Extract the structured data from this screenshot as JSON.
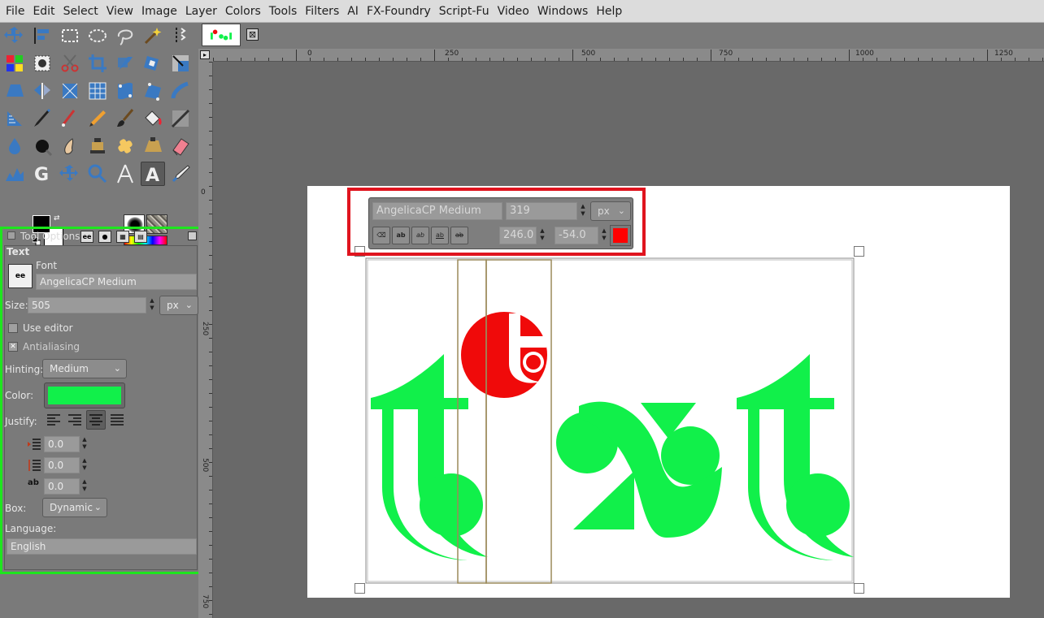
{
  "menubar": {
    "items": [
      "File",
      "Edit",
      "Select",
      "View",
      "Image",
      "Layer",
      "Colors",
      "Tools",
      "Filters",
      "AI",
      "FX-Foundry",
      "Script-Fu",
      "Video",
      "Windows",
      "Help"
    ]
  },
  "toolbox": {
    "tools": [
      "move-tool",
      "align-tool",
      "rect-select-tool",
      "ellipse-select-tool",
      "free-select-tool",
      "fuzzy-select-tool",
      "scissors-paths-tool",
      "select-by-color-tool",
      "foreground-select-tool",
      "scissors-tool",
      "crop-tool",
      "rotate-tool",
      "unified-transform-tool",
      "scale-tool",
      "perspective-tool",
      "flip-tool",
      "cage-tool",
      "grid-transform-tool",
      "warp-tool",
      "handle-transform-tool",
      "smudge-warp-tool",
      "measure-tool",
      "ink-tool",
      "airbrush-tool",
      "pencil-tool",
      "paintbrush-tool",
      "bucket-fill-tool",
      "blend-tool",
      "blur-tool",
      "dodge-burn-tool",
      "smudge-tool",
      "clone-tool",
      "heal-tool",
      "perspective-clone-tool",
      "eraser-tool",
      "levels-tool",
      "gegl-tool",
      "zoom-move-tool",
      "zoom-tool",
      "compass-tool",
      "text-tool",
      "color-picker-tool"
    ],
    "active_tool": "text-tool",
    "fg_color": "#000000",
    "bg_color": "#ffffff"
  },
  "tool_options": {
    "title": "Tool Options",
    "section": "Text",
    "font_label": "Font",
    "font_value": "AngelicaCP Medium",
    "size_label": "Size:",
    "size_value": "505",
    "size_unit": "px",
    "use_editor_label": "Use editor",
    "use_editor_checked": false,
    "antialiasing_label": "Antialiasing",
    "antialiasing_checked": true,
    "hinting_label": "Hinting:",
    "hinting_value": "Medium",
    "color_label": "Color:",
    "text_color": "#11f04a",
    "justify_label": "Justify:",
    "justify_active": "center",
    "indent_value": "0.0",
    "line_spacing_value": "0.0",
    "letter_spacing_value": "0.0",
    "box_label": "Box:",
    "box_value": "Dynamic",
    "language_label": "Language:",
    "language_value": "English",
    "highlight_color": "#1ee61e"
  },
  "rulers": {
    "h_labels": [
      "0",
      "250",
      "500",
      "750",
      "1000",
      "1250"
    ],
    "v_labels": [
      "0",
      "250",
      "500",
      "750"
    ]
  },
  "style_editor": {
    "font": "AngelicaCP Medium",
    "size": "319",
    "unit": "px",
    "baseline": "246.0",
    "kerning": "-54.0",
    "color": "#ff0000",
    "highlight_color": "#e0141e"
  },
  "canvas": {
    "text_content": "text",
    "glyph_color": "#11f04a",
    "selected_glyph_color": "#f00a0a"
  }
}
